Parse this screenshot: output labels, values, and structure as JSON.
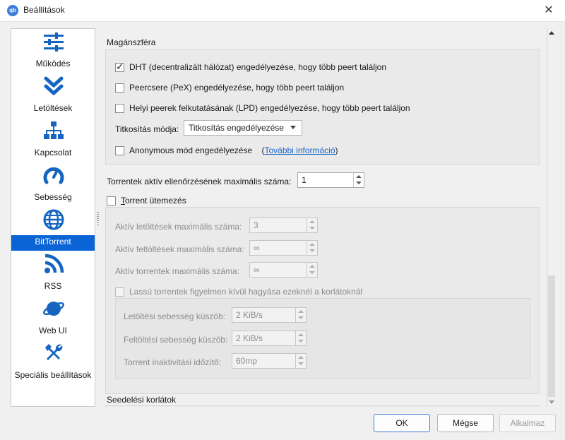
{
  "window": {
    "title": "Beállítások",
    "app_icon": "qb"
  },
  "colors": {
    "accent": "#0a64d6",
    "icon_blue": "#1565c0",
    "link": "#1a64c8"
  },
  "sidebar": {
    "items": [
      {
        "label": "Működés",
        "icon": "sliders-icon"
      },
      {
        "label": "Letöltések",
        "icon": "double-chevron-down-icon"
      },
      {
        "label": "Kapcsolat",
        "icon": "network-icon"
      },
      {
        "label": "Sebesség",
        "icon": "speedometer-icon"
      },
      {
        "label": "BitTorrent",
        "icon": "globe-icon",
        "active": true
      },
      {
        "label": "RSS",
        "icon": "rss-icon"
      },
      {
        "label": "Web UI",
        "icon": "planet-icon"
      },
      {
        "label": "Speciális beállítások",
        "icon": "tools-icon"
      }
    ]
  },
  "privacy": {
    "title": "Magánszféra",
    "dht_label": "DHT (decentralizált hálózat) engedélyezése, hogy több peert találjon",
    "dht_checked": true,
    "pex_label": "Peercsere (PeX) engedélyezése, hogy több peert találjon",
    "pex_checked": false,
    "lpd_label": "Helyi peerek felkutatásának (LPD) engedélyezése, hogy több peert találjon",
    "lpd_checked": false,
    "encryption_label": "Titkosítás módja:",
    "encryption_value": "Titkosítás engedélyezése",
    "anon_label": "Anonymous mód engedélyezése",
    "anon_checked": false,
    "anon_link_open": "(",
    "anon_link": "További információ",
    "anon_link_close": ")"
  },
  "max_checks": {
    "label": "Torrentek aktív ellenőrzésének maximális száma:",
    "value": "1"
  },
  "queueing": {
    "label_underlined": "T",
    "label_rest": "orrent ütemezés",
    "checked": false,
    "max_downloads_label": "Aktív letöltések maximális száma:",
    "max_downloads_value": "3",
    "max_uploads_label": "Aktív feltöltések maximális száma:",
    "max_uploads_value": "∞",
    "max_torrents_label": "Aktív torrentek maximális száma:",
    "max_torrents_value": "∞",
    "slow_label": "Lassú torrentek figyelmen kívül hagyása ezeknél a korlátoknál",
    "slow_checked": false,
    "dl_threshold_label": "Letöltési sebesség küszöb:",
    "dl_threshold_value": "2 KiB/s",
    "ul_threshold_label": "Feltöltési sebesség küszöb:",
    "ul_threshold_value": "2 KiB/s",
    "inactivity_label": "Torrent inaktivitási időzítő:",
    "inactivity_value": "60mp"
  },
  "seeding": {
    "title": "Seedelési korlátok"
  },
  "buttons": {
    "ok": "OK",
    "cancel": "Mégse",
    "apply": "Alkalmaz"
  }
}
